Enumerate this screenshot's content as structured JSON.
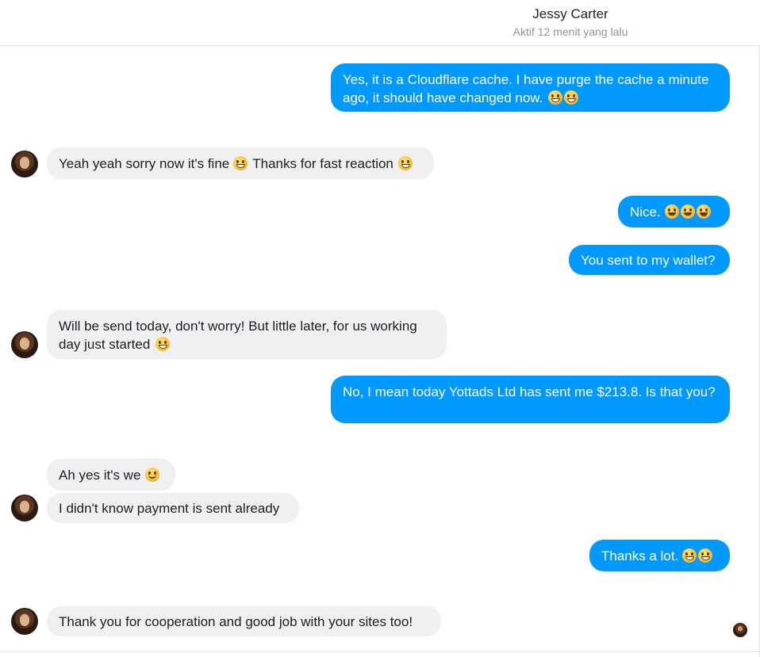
{
  "header": {
    "name": "Jessy Carter",
    "status": "Aktif 12 menit yang lalu"
  },
  "messages": [
    {
      "side": "out",
      "text": "Yes, it is a Cloudflare cache. I have purge the cache a minute ago, it should have changed now.",
      "emoji": [
        "grinning-face",
        "grinning-face"
      ]
    },
    {
      "side": "in",
      "text": "Yeah yeah sorry now it's fine",
      "mid_emoji": "grinning-face",
      "text2": "Thanks for fast reaction",
      "emoji": [
        "grinning-squinting-face"
      ]
    },
    {
      "side": "out",
      "text": "Nice.",
      "emoji": [
        "grinning-sweat-face",
        "grinning-sweat-face",
        "winking-tongue-face"
      ]
    },
    {
      "side": "out",
      "text": "You sent to my wallet?"
    },
    {
      "side": "in",
      "text": "Will be send today, don't worry! But little later, for us working day just started",
      "emoji": [
        "grinning-face"
      ]
    },
    {
      "side": "out",
      "text": "No, I mean today Yottads Ltd has sent me $213.8. Is that you?"
    },
    {
      "side": "in",
      "text": "Ah yes it's we",
      "emoji": [
        "smiling-face"
      ]
    },
    {
      "side": "in",
      "text": "I didn't know payment is sent already"
    },
    {
      "side": "out",
      "text": "Thanks a lot.",
      "emoji": [
        "beaming-face",
        "beaming-face"
      ]
    },
    {
      "side": "in",
      "text": "Thank you for cooperation and good job with your sites too!"
    }
  ]
}
